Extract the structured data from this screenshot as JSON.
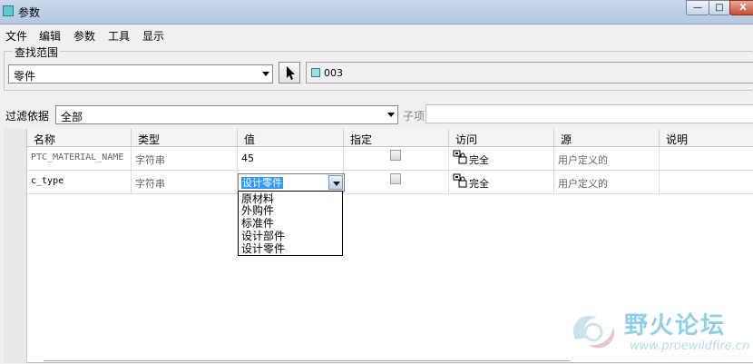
{
  "window": {
    "title": "参数",
    "controls": {
      "minimize": "—",
      "maximize": "□",
      "close": "X"
    }
  },
  "menu": [
    "文件",
    "编辑",
    "参数",
    "工具",
    "显示"
  ],
  "scope": {
    "group_label": "查找范围",
    "type_value": "零件",
    "model_name": "003"
  },
  "filter": {
    "label": "过滤依据",
    "value": "全部",
    "sub_label": "子项",
    "sub_value": ""
  },
  "table": {
    "headers": [
      "名称",
      "类型",
      "值",
      "指定",
      "访问",
      "源",
      "说明"
    ],
    "rows": [
      {
        "name": "PTC_MATERIAL_NAME",
        "type": "字符串",
        "value": "45",
        "designated": false,
        "access": "完全",
        "source": "用户定义的",
        "description": ""
      },
      {
        "name": "c_type",
        "type": "字符串",
        "value": "设计零件",
        "designated": false,
        "access": "完全",
        "source": "用户定义的",
        "description": ""
      }
    ]
  },
  "value_dropdown": {
    "selected": "设计零件",
    "options": [
      "原材料",
      "外购件",
      "标准件",
      "设计部件",
      "设计零件"
    ]
  },
  "watermark": {
    "title": "野火论坛",
    "url": "www.proewildfire.cn"
  },
  "colors": {
    "selection": "#3399ff",
    "titlebar": "#c9d8ea",
    "close_button": "#c74f35"
  },
  "icons": {
    "app": "parameter-app-icon",
    "pick": "arrow-pointer-icon",
    "model": "part-cube-icon",
    "access": "lock-icon"
  }
}
